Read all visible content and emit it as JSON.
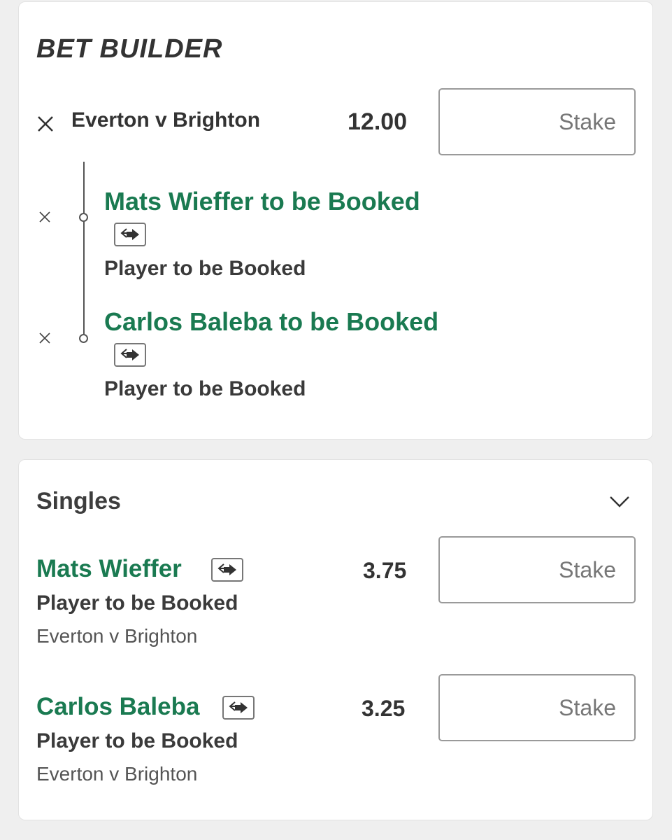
{
  "bet_builder": {
    "title": "BET BUILDER",
    "event": "Everton v Brighton",
    "odds": "12.00",
    "stake_placeholder": "Stake",
    "legs": [
      {
        "selection": "Mats Wieffer to be Booked",
        "market": "Player to be Booked"
      },
      {
        "selection": "Carlos Baleba to be Booked",
        "market": "Player to be Booked"
      }
    ]
  },
  "singles": {
    "title": "Singles",
    "items": [
      {
        "selection": "Mats Wieffer",
        "market": "Player to be Booked",
        "event": "Everton v Brighton",
        "odds": "3.75",
        "stake_placeholder": "Stake"
      },
      {
        "selection": "Carlos Baleba",
        "market": "Player to be Booked",
        "event": "Everton v Brighton",
        "odds": "3.25",
        "stake_placeholder": "Stake"
      }
    ]
  },
  "icons": {
    "close": "close-icon",
    "swap": "swap-arrows-icon",
    "chevron": "chevron-down-icon"
  },
  "colors": {
    "selection_green": "#1a7a51",
    "text_dark": "#333333",
    "background": "#efefef"
  }
}
